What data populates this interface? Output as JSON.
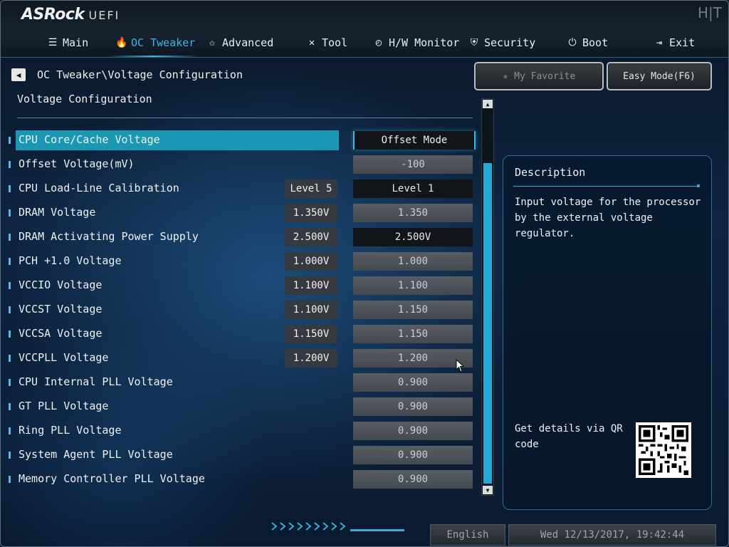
{
  "header": {
    "logo": "ASRock",
    "logo_suffix": "UEFI",
    "brand_mark": "H|T",
    "nav": [
      {
        "label": "Main",
        "icon": "list-icon"
      },
      {
        "label": "OC Tweaker",
        "icon": "flame-icon"
      },
      {
        "label": "Advanced",
        "icon": "star-icon"
      },
      {
        "label": "Tool",
        "icon": "tools-icon"
      },
      {
        "label": "H/W Monitor",
        "icon": "monitor-icon"
      },
      {
        "label": "Security",
        "icon": "shield-icon"
      },
      {
        "label": "Boot",
        "icon": "power-icon"
      },
      {
        "label": "Exit",
        "icon": "exit-icon"
      }
    ],
    "active_tab": "OC Tweaker"
  },
  "breadcrumb": "OC Tweaker\\Voltage Configuration",
  "buttons": {
    "favorite": "My Favorite",
    "easy_mode": "Easy Mode(F6)"
  },
  "section_title": "Voltage Configuration",
  "settings": [
    {
      "label": "CPU Core/Cache Voltage",
      "current": "",
      "value": "Offset Mode"
    },
    {
      "label": " Offset Voltage(mV)",
      "current": "",
      "value": "-100"
    },
    {
      "label": "CPU Load-Line Calibration",
      "current": "Level 5",
      "value": "Level 1"
    },
    {
      "label": "DRAM Voltage",
      "current": "1.350V",
      "value": "1.350"
    },
    {
      "label": "DRAM Activating Power Supply",
      "current": "2.500V",
      "value": "2.500V"
    },
    {
      "label": "PCH +1.0 Voltage",
      "current": "1.000V",
      "value": "1.000"
    },
    {
      "label": "VCCIO Voltage",
      "current": "1.100V",
      "value": "1.100"
    },
    {
      "label": "VCCST Voltage",
      "current": "1.100V",
      "value": "1.150"
    },
    {
      "label": "VCCSA Voltage",
      "current": "1.150V",
      "value": "1.150"
    },
    {
      "label": "VCCPLL Voltage",
      "current": "1.200V",
      "value": "1.200"
    },
    {
      "label": "CPU Internal PLL Voltage",
      "current": "",
      "value": "0.900"
    },
    {
      "label": "GT PLL Voltage",
      "current": "",
      "value": "0.900"
    },
    {
      "label": "Ring PLL Voltage",
      "current": "",
      "value": "0.900"
    },
    {
      "label": "System Agent PLL Voltage",
      "current": "",
      "value": "0.900"
    },
    {
      "label": "Memory Controller PLL Voltage",
      "current": "",
      "value": "0.900"
    }
  ],
  "description": {
    "title": "Description",
    "text": "Input voltage for the processor by the external voltage regulator.",
    "qr_text": "Get details via QR code"
  },
  "footer": {
    "language": "English",
    "datetime": "Wed 12/13/2017, 19:42:44"
  },
  "colors": {
    "accent": "#3fb6e6",
    "selected_row": "#1a97b3",
    "scroll_thumb": "#23a9d8"
  }
}
